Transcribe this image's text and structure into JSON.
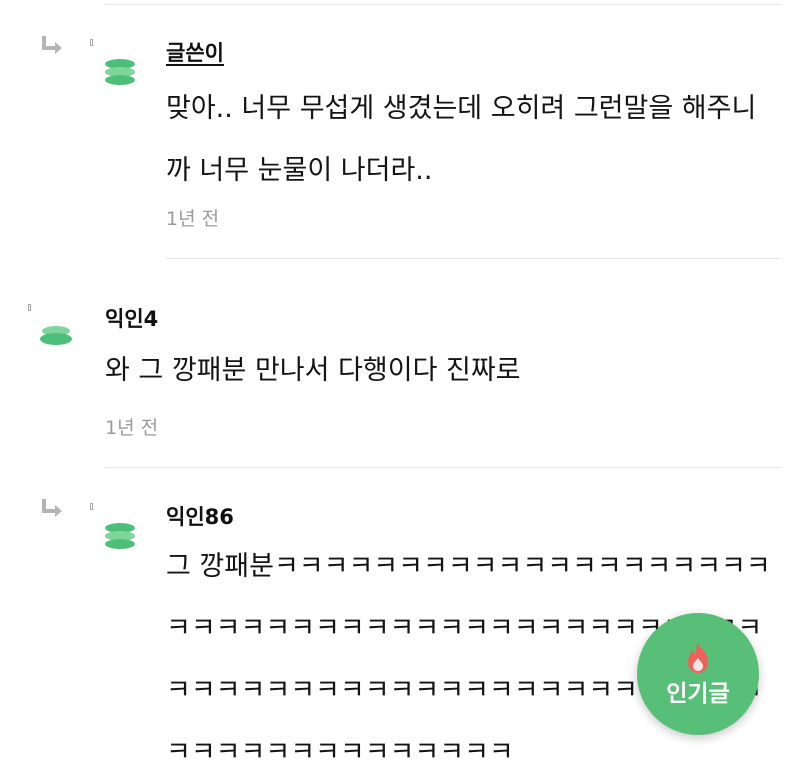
{
  "comments": [
    {
      "author": "글쓴이",
      "text": "맞아.. 너무 무섭게 생겼는데 오히려 그런말을 해주니까 너무 눈물이 나더라..",
      "time": "1년 전"
    },
    {
      "author": "익인4",
      "text": "와 그 깡패분 만나서 다행이다 진짜로",
      "time": "1년 전"
    },
    {
      "author": "익인86",
      "text": "그 깡패분ㅋㅋㅋㅋㅋㅋㅋㅋㅋㅋㅋㅋㅋㅋㅋㅋㅋㅋㅋㅋㅋㅋㅋㅋㅋㅋㅋㅋㅋㅋㅋㅋㅋㅋㅋㅋㅋㅋㅋㅋㅋㅋㅋㅋㅋㅋㅋㅋㅋㅋㅋㅋㅋㅋㅋㅋㅋㅋㅋㅋㅋㅋㅋㅋㅋㅋㅋㅋㅋㅋㅋㅋㅋㅋㅋㅋㅋㅋㅋㅋㅋㅋ"
    }
  ],
  "fab": {
    "label": "인기글",
    "icon": "fire-icon"
  },
  "colors": {
    "accent": "#57bf78",
    "avatar": "#4cc07a",
    "fire": "#f0615b",
    "muted": "#9b9b9b"
  }
}
